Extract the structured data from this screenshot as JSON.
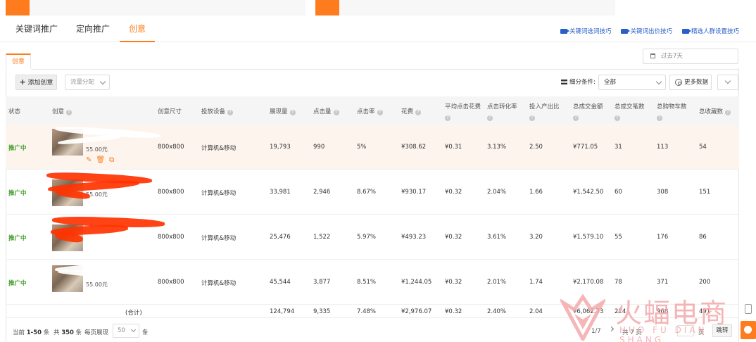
{
  "tabs": [
    {
      "label": "关键词推广",
      "active": false
    },
    {
      "label": "定向推广",
      "active": false
    },
    {
      "label": "创意",
      "active": true
    }
  ],
  "tip_links": [
    "关键词选词技巧",
    "关键词出价技巧",
    "精选人群设置技巧"
  ],
  "panel": {
    "tab_label": "创意",
    "date_range": "过去7天"
  },
  "toolbar": {
    "add_label": "添加创意",
    "flow_placeholder": "流量分配",
    "filter_label": "细分条件:",
    "filter_value": "全部",
    "more_data_label": "更多数据"
  },
  "table": {
    "headers": {
      "status": "状态",
      "creative": "创意",
      "size": "创意尺寸",
      "device": "投放设备",
      "impressions": "展现量",
      "clicks": "点击量",
      "ctr": "点击率",
      "cost": "花费",
      "avg_cpc": "平均点击花费",
      "cvr": "点击转化率",
      "roi": "投入产出比",
      "gmv": "总成交金额",
      "orders": "总成交笔数",
      "carts": "总购物车数",
      "favs": "总收藏数"
    },
    "rows": [
      {
        "status": "推广中",
        "price_tail": "55.00元",
        "size": "800x800",
        "device": "计算机&移动",
        "impressions": "19,793",
        "clicks": "990",
        "ctr": "5%",
        "cost": "¥308.62",
        "avg_cpc": "¥0.31",
        "cvr": "3.13%",
        "roi": "2.50",
        "gmv": "¥771.05",
        "orders": "31",
        "carts": "113",
        "favs": "54"
      },
      {
        "status": "推广中",
        "price_tail": "55.00元",
        "size": "800x800",
        "device": "计算机&移动",
        "impressions": "33,981",
        "clicks": "2,946",
        "ctr": "8.67%",
        "cost": "¥930.17",
        "avg_cpc": "¥0.32",
        "cvr": "2.04%",
        "roi": "1.66",
        "gmv": "¥1,542.50",
        "orders": "60",
        "carts": "308",
        "favs": "151"
      },
      {
        "status": "推广中",
        "price_tail": "",
        "size": "800x800",
        "device": "计算机&移动",
        "impressions": "25,476",
        "clicks": "1,522",
        "ctr": "5.97%",
        "cost": "¥493.23",
        "avg_cpc": "¥0.32",
        "cvr": "3.61%",
        "roi": "3.20",
        "gmv": "¥1,579.10",
        "orders": "55",
        "carts": "176",
        "favs": "86"
      },
      {
        "status": "推广中",
        "price_tail": "55.00元",
        "size": "800x800",
        "device": "计算机&移动",
        "impressions": "45,544",
        "clicks": "3,877",
        "ctr": "8.51%",
        "cost": "¥1,244.05",
        "avg_cpc": "¥0.32",
        "cvr": "2.01%",
        "roi": "1.74",
        "gmv": "¥2,170.08",
        "orders": "78",
        "carts": "371",
        "favs": "200"
      }
    ],
    "total": {
      "label": "(合计)",
      "impressions": "124,794",
      "clicks": "9,335",
      "ctr": "7.48%",
      "cost": "¥2,976.07",
      "avg_cpc": "¥0.32",
      "cvr": "2.40%",
      "roi": "2.04",
      "gmv": "¥6,062.73",
      "orders": "224",
      "carts": "968",
      "favs": "491"
    }
  },
  "footer": {
    "range_prefix": "当前",
    "range": "1-50",
    "range_suffix": "条",
    "total_prefix": "共",
    "total": "350",
    "total_suffix": "条",
    "per_page_label": "每页展现",
    "per_page": "50",
    "per_page_suffix": "条",
    "page": "1/7",
    "total_pages": "共 7 页",
    "goto_label": "页",
    "jump_label": "跳转"
  },
  "watermark": {
    "cn": "火蝠电商",
    "py": "HUO FU DIAN SHANG"
  },
  "colors": {
    "accent": "#ff7c1e",
    "link": "#2a5ec9",
    "status_green": "#3b9a23",
    "highlight_row": "#fdf4ee"
  }
}
